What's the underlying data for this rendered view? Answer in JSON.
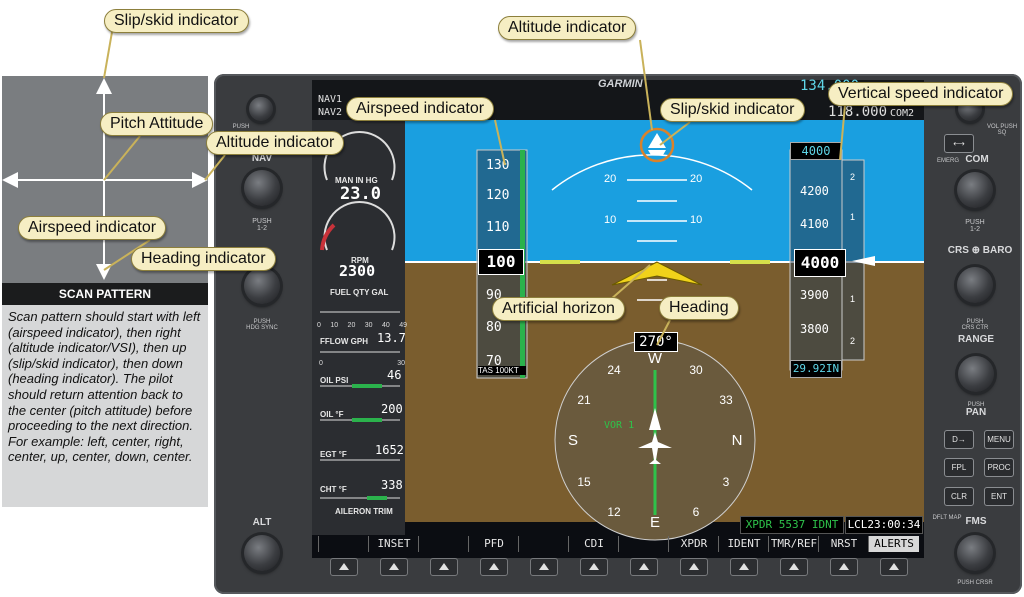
{
  "callouts": {
    "slip_skid_top": "Slip/skid indicator",
    "pitch_attitude": "Pitch Attitude",
    "altitude_left": "Altitude indicator",
    "airspeed_left": "Airspeed indicator",
    "heading_left": "Heading indicator",
    "altitude_top": "Altitude indicator",
    "airspeed_pfd": "Airspeed indicator",
    "slip_skid_pfd": "Slip/skid indicator",
    "vsi": "Vertical speed indicator",
    "artificial_horizon": "Artificial horizon",
    "heading_pfd": "Heading"
  },
  "scan_pattern": {
    "title": "SCAN PATTERN",
    "description": "Scan pattern should start with left (airspeed indicator), then right (altitude indicator/VSI), then up (slip/skid indicator), then down (heading indicator). The pilot should return attention back to the center (pitch attitude) before proceeding to the next direction. For example: left, center, right, center, up, center, down, center."
  },
  "bezel_left": {
    "push_top": "PUSH",
    "nav_label": "NAV",
    "push_12": "PUSH\n1-2",
    "push_hdg_sync": "PUSH\nHDG SYNC",
    "alt_label": "ALT"
  },
  "bezel_right": {
    "vol_push_sq": "VOL PUSH SQ",
    "emerg": "EMERG",
    "com_label": "COM",
    "push_12": "PUSH\n1-2",
    "crs_baro": "CRS ⊕ BARO",
    "push_crs_ctr": "PUSH\nCRS CTR",
    "range": "RANGE",
    "push": "PUSH",
    "pan": "PAN",
    "btn_direct": "D→",
    "btn_menu": "MENU",
    "btn_fpl": "FPL",
    "btn_proc": "PROC",
    "btn_clr": "CLR",
    "btn_ent": "ENT",
    "dflt_map": "DFLT MAP",
    "fms": "FMS",
    "push_crsr": "PUSH CRSR"
  },
  "topbar": {
    "nav1": "NAV1",
    "nav2": "NAV2",
    "brand": "GARMIN",
    "com_freq": "134.000",
    "com2_freq": "118.000",
    "com2_label": "COM2"
  },
  "engine": {
    "man_label": "MAN IN HG",
    "man_value": "23.0",
    "rpm_label": "RPM",
    "rpm_value": "2300",
    "fuel_label": "FUEL QTY GAL",
    "fuel_ticks": [
      "0",
      "10",
      "20",
      "30",
      "40",
      "49"
    ],
    "fflow_label": "FFLOW GPH",
    "fflow_value": "13.7",
    "fflow_ticks": [
      "0",
      "30"
    ],
    "oil_psi_label": "OIL PSI",
    "oil_psi_value": "46",
    "oil_f_label": "OIL °F",
    "oil_f_value": "200",
    "egt_label": "EGT °F",
    "egt_value": "1652",
    "cht_label": "CHT °F",
    "cht_value": "338",
    "aileron_label": "AILERON TRIM"
  },
  "pfd": {
    "airspeed_ticks": [
      "130",
      "120",
      "110",
      "90",
      "80",
      "70"
    ],
    "airspeed_value": "100",
    "tas": "TAS 100KT",
    "pitch_labels": [
      "20",
      "20",
      "10",
      "10"
    ],
    "altitude_ticks": [
      "4200",
      "4100",
      "3900",
      "3800"
    ],
    "altitude_selected": "4000",
    "altitude_value": "4000",
    "vsi_ticks": [
      "2",
      "1",
      "1",
      "2"
    ],
    "baro": "29.92IN",
    "heading_value": "270°",
    "compass_labels": [
      "N",
      "3",
      "6",
      "E",
      "12",
      "15",
      "S",
      "21",
      "24",
      "W",
      "30",
      "33"
    ],
    "vor_label": "VOR 1",
    "xpdr": "XPDR 5537 IDNT",
    "lcl_time": "LCL23:00:34"
  },
  "softkeys": [
    "",
    "INSET",
    "",
    "PFD",
    "",
    "CDI",
    "",
    "XPDR",
    "IDENT",
    "TMR/REF",
    "NRST",
    "ALERTS"
  ],
  "colors": {
    "sky": "#1a9fe0",
    "ground": "#7a5d2e",
    "callout_bg": "#f6eec3",
    "aircraft_symbol": "#f0d21a"
  }
}
